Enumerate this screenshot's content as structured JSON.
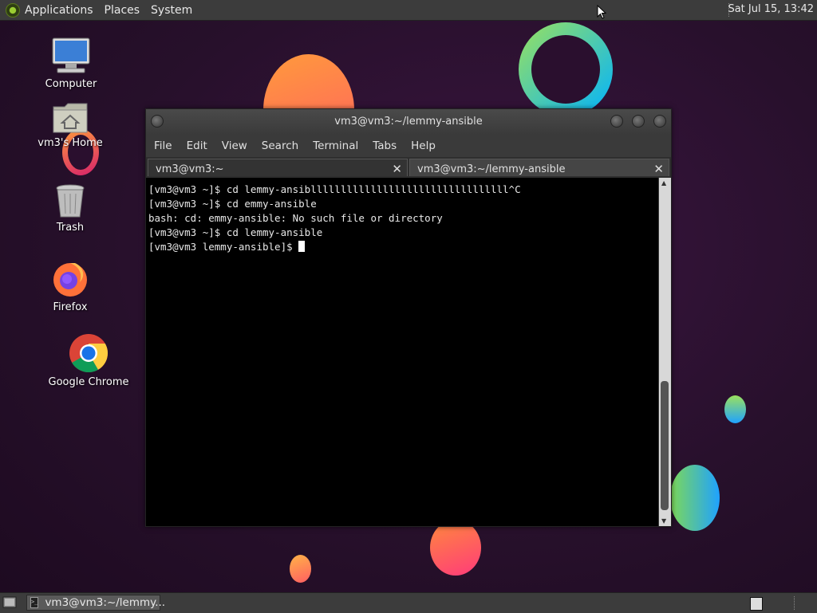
{
  "top_panel": {
    "menus": [
      "Applications",
      "Places",
      "System"
    ],
    "clock": "Sat Jul 15, 13:42"
  },
  "desktop_icons": [
    {
      "label": "Computer",
      "icon": "computer-icon"
    },
    {
      "label": "vm3's Home",
      "icon": "home-folder-icon"
    },
    {
      "label": "Trash",
      "icon": "trash-icon"
    },
    {
      "label": "Firefox",
      "icon": "firefox-icon"
    },
    {
      "label": "Google Chrome",
      "icon": "chrome-icon"
    }
  ],
  "terminal": {
    "title": "vm3@vm3:~/lemmy-ansible",
    "menu": [
      "File",
      "Edit",
      "View",
      "Search",
      "Terminal",
      "Tabs",
      "Help"
    ],
    "tabs": [
      {
        "label": "vm3@vm3:~",
        "active": false
      },
      {
        "label": "vm3@vm3:~/lemmy-ansible",
        "active": true
      }
    ],
    "lines": [
      "[vm3@vm3 ~]$ cd lemmy-ansiblllllllllllllllllllllllllllllllll^C",
      "[vm3@vm3 ~]$ cd emmy-ansible",
      "bash: cd: emmy-ansible: No such file or directory",
      "[vm3@vm3 ~]$ cd lemmy-ansible",
      "[vm3@vm3 lemmy-ansible]$ "
    ]
  },
  "bottom_panel": {
    "task_label": "vm3@vm3:~/lemmy..."
  },
  "colors": {
    "panel": "#3c3c3c",
    "terminal_bg": "#000000",
    "desktop_bg": "#2a0f2e"
  }
}
